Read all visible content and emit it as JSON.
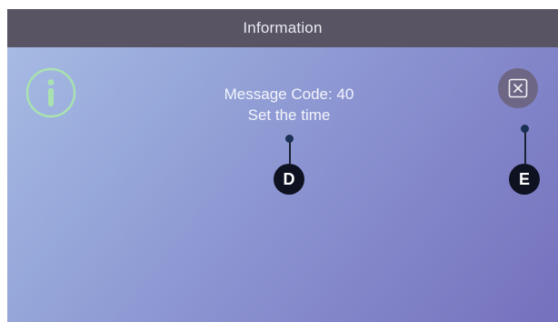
{
  "header": {
    "title": "Information"
  },
  "message": {
    "line1": "Message Code: 40",
    "line2": "Set the time"
  },
  "icons": {
    "info": "info-circle-icon",
    "close": "close-box-icon"
  },
  "callouts": {
    "d_label": "D",
    "e_label": "E"
  },
  "colors": {
    "title_bar": "#585464",
    "info_icon": "#a9e2b0",
    "close_button": "#6d6684",
    "badge": "#0e1220"
  }
}
